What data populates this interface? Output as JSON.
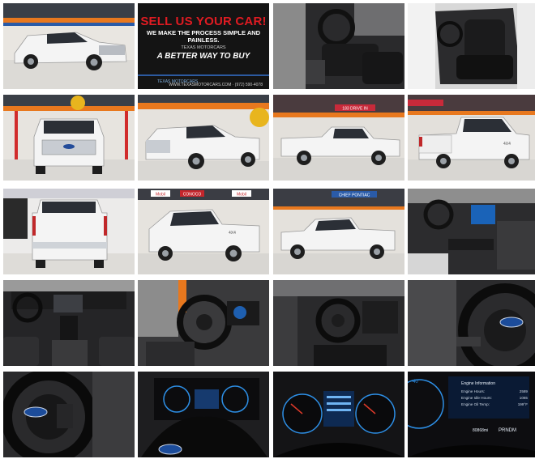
{
  "promo": {
    "headline": "SELL US YOUR CAR!",
    "subline": "WE MAKE THE PROCESS SIMPLE AND PAINLESS.",
    "brand_small": "TEXAS MOTORCARS",
    "tagline": "A BETTER WAY TO BUY",
    "logo_text": "TEXAS MOTORCARS",
    "contact": "WWW.TEXASMOTORCARS.COM · (972) 590-4078"
  },
  "signs": {
    "drive_in": "183 DRIVE IN",
    "conoco": "CONOCO",
    "mobil": "Mobil",
    "pontiac": "CHIEF PONTIAC",
    "badge": "4X4"
  },
  "cluster": {
    "title": "Engine Information",
    "rows": [
      {
        "label": "Engine Hours:",
        "value": "2589"
      },
      {
        "label": "Engine Idle Hours:",
        "value": "1065"
      },
      {
        "label": "Engine Oil Temp:",
        "value": "199°F"
      }
    ],
    "odometer": "80868mi",
    "gear": "PRNDM"
  },
  "colors": {
    "truck": "#f2f2f2",
    "showroom_wall": "#e9e6e1",
    "accent_orange": "#e8781e",
    "interior": "#1c1c1e",
    "gauge_blue": "#2d8fe6"
  }
}
